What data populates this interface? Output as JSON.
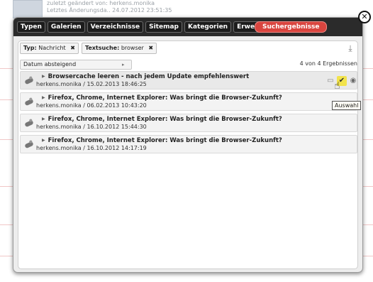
{
  "background": {
    "meta_line1": "zuletzt geändert von:   herkens.monika",
    "meta_line2": "Letztes Änderungsda.. 24.07.2012 23:51:35"
  },
  "tabs": [
    {
      "label": "Typen"
    },
    {
      "label": "Galerien"
    },
    {
      "label": "Verzeichnisse"
    },
    {
      "label": "Sitemap"
    },
    {
      "label": "Kategorien"
    },
    {
      "label": "Erweitert"
    },
    {
      "label": "Suchergebnisse"
    }
  ],
  "close_glyph": "✕",
  "filters": [
    {
      "key": "Typ:",
      "value": "Nachricht",
      "remove": "✖"
    },
    {
      "key": "Textsuche:",
      "value": "browser",
      "remove": "✖"
    }
  ],
  "sort": {
    "label": "Datum absteigend",
    "arrow": "▸"
  },
  "result_count": "4 von 4 Ergebnissen",
  "results": [
    {
      "title": "Browsercache leeren - nach jedem Update empfehlenswert",
      "meta": "herkens.monika / 15.02.2013 18:46:25"
    },
    {
      "title": "Firefox, Chrome, Internet Explorer: Was bringt die Browser-Zukunft?",
      "meta": "herkens.monika / 06.02.2013 10:43:20"
    },
    {
      "title": "Firefox, Chrome, Internet Explorer: Was bringt die Browser-Zukunft?",
      "meta": "herkens.monika / 16.10.2012 15:44:30"
    },
    {
      "title": "Firefox, Chrome, Internet Explorer: Was bringt die Browser-Zukunft?",
      "meta": "herkens.monika / 16.10.2012 14:17:19"
    }
  ],
  "tooltip": "Auswahl",
  "icons": {
    "download": "download-icon",
    "comment": "comment-icon",
    "select": "check-icon",
    "view": "view-icon"
  }
}
